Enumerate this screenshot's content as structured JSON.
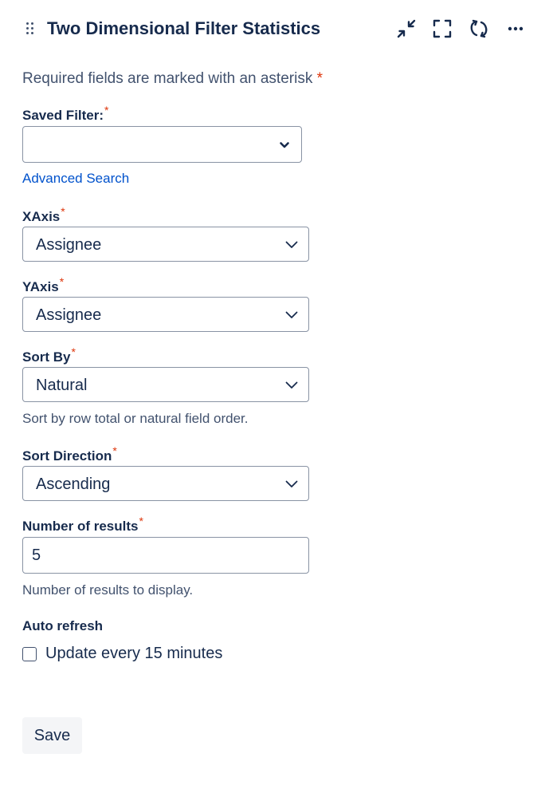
{
  "header": {
    "title": "Two Dimensional Filter Statistics"
  },
  "form": {
    "required_note": "Required fields are marked with an asterisk",
    "asterisk": "*",
    "saved_filter": {
      "label": "Saved Filter:",
      "value": ""
    },
    "advanced_search_link": "Advanced Search",
    "xaxis": {
      "label": "XAxis",
      "value": "Assignee"
    },
    "yaxis": {
      "label": "YAxis",
      "value": "Assignee"
    },
    "sort_by": {
      "label": "Sort By",
      "value": "Natural",
      "help": "Sort by row total or natural field order."
    },
    "sort_direction": {
      "label": "Sort Direction",
      "value": "Ascending"
    },
    "number_of_results": {
      "label": "Number of results",
      "value": "5",
      "help": "Number of results to display."
    },
    "auto_refresh": {
      "label": "Auto refresh",
      "checkbox_label": "Update every 15 minutes",
      "checked": false
    },
    "save_button": "Save"
  },
  "icons": {
    "drag_handle": "drag-handle-icon",
    "minimize": "minimize-icon",
    "fullscreen": "fullscreen-icon",
    "refresh": "refresh-icon",
    "more": "more-icon",
    "chevron": "chevron-down-icon"
  },
  "colors": {
    "link": "#0052cc",
    "required": "#de350b",
    "text": "#172b4d",
    "subtle_text": "#42526e"
  }
}
